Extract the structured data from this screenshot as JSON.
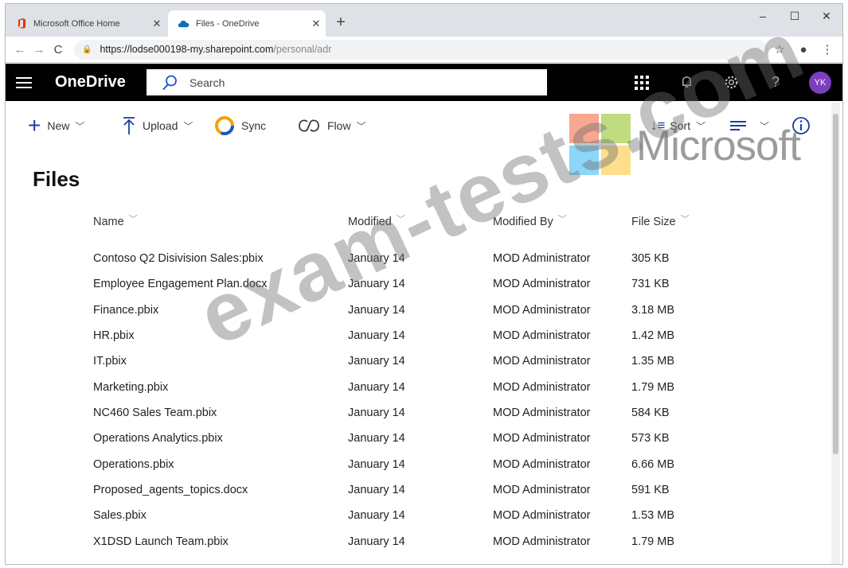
{
  "browser": {
    "tabs": [
      {
        "title": "Microsoft Office Home",
        "icon": "office-icon",
        "active": false
      },
      {
        "title": "Files - OneDrive",
        "icon": "onedrive-cloud-icon",
        "active": true
      }
    ],
    "url_host": "https://lodse000198-my.sharepoint.com",
    "url_path": "/personal/adr",
    "colors": {
      "tabbar": "#dee1e6",
      "office_red": "#d83b01",
      "onedrive_blue": "#0f6cbd"
    }
  },
  "suite": {
    "brand": "OneDrive",
    "search_placeholder": "Search",
    "avatar_initials": "YK",
    "icons": [
      "waffle-icon",
      "bell-icon",
      "gear-icon",
      "help-icon"
    ],
    "colors": {
      "bar": "#000000",
      "avatar": "#7b3fbf"
    }
  },
  "commands": {
    "new": "New",
    "upload": "Upload",
    "sync": "Sync",
    "flow": "Flow",
    "sort": "Sort"
  },
  "watermark": {
    "brand_word": "Microsoft",
    "site_text": "exam-tests.com",
    "logo_colors": [
      "#f25022",
      "#7fba00",
      "#00a4ef",
      "#ffb900"
    ]
  },
  "page_title": "Files",
  "columns": {
    "name": "Name",
    "modified": "Modified",
    "modified_by": "Modified By",
    "file_size": "File Size"
  },
  "files": [
    {
      "name": "Contoso Q2 Disivision Sales:pbix",
      "modified": "January 14",
      "modified_by": "MOD Administrator",
      "size": "305 KB"
    },
    {
      "name": "Employee Engagement Plan.docx",
      "modified": "January 14",
      "modified_by": "MOD Administrator",
      "size": "731 KB"
    },
    {
      "name": "Finance.pbix",
      "modified": "January 14",
      "modified_by": "MOD Administrator",
      "size": "3.18 MB"
    },
    {
      "name": "HR.pbix",
      "modified": "January 14",
      "modified_by": "MOD Administrator",
      "size": "1.42 MB"
    },
    {
      "name": "IT.pbix",
      "modified": "January 14",
      "modified_by": "MOD Administrator",
      "size": "1.35 MB"
    },
    {
      "name": "Marketing.pbix",
      "modified": "January 14",
      "modified_by": "MOD Administrator",
      "size": "1.79 MB"
    },
    {
      "name": "NC460 Sales Team.pbix",
      "modified": "January 14",
      "modified_by": "MOD Administrator",
      "size": "584 KB"
    },
    {
      "name": "Operations Analytics.pbix",
      "modified": "January 14",
      "modified_by": "MOD Administrator",
      "size": "573 KB"
    },
    {
      "name": "Operations.pbix",
      "modified": "January 14",
      "modified_by": "MOD Administrator",
      "size": "6.66 MB"
    },
    {
      "name": "Proposed_agents_topics.docx",
      "modified": "January 14",
      "modified_by": "MOD Administrator",
      "size": "591 KB"
    },
    {
      "name": "Sales.pbix",
      "modified": "January 14",
      "modified_by": "MOD Administrator",
      "size": "1.53 MB"
    },
    {
      "name": "X1DSD Launch Team.pbix",
      "modified": "January 14",
      "modified_by": "MOD Administrator",
      "size": "1.79 MB"
    }
  ]
}
